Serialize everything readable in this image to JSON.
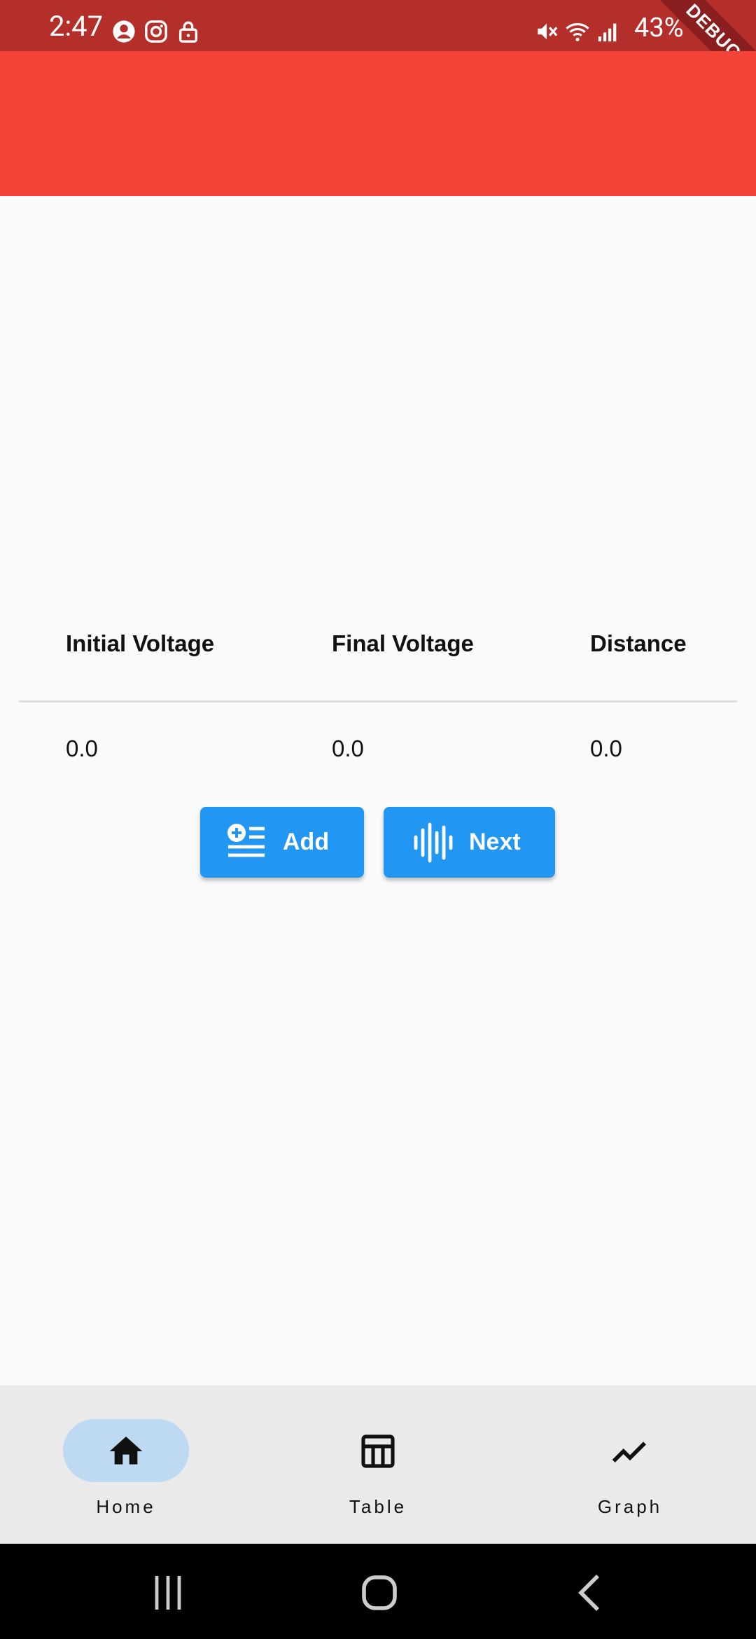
{
  "status_bar": {
    "time": "2:47",
    "battery": "43%",
    "left_icons": [
      "account-circle-icon",
      "instagram-icon",
      "lock-icon"
    ],
    "right_icons": [
      "mute-icon",
      "wifi-icon",
      "signal-icon"
    ]
  },
  "debug_banner": "DEBUG",
  "colors": {
    "status_bar": "#b52f2a",
    "app_bar": "#f44336",
    "button": "#2196f3",
    "nav_active": "#bedaf2",
    "bottom_nav_bg": "#eaeaea"
  },
  "table": {
    "headers": [
      "Initial Voltage",
      "Final Voltage",
      "Distance"
    ],
    "row": [
      "0.0",
      "0.0",
      "0.0"
    ]
  },
  "buttons": {
    "add": {
      "label": "Add",
      "icon": "playlist-add-icon"
    },
    "next": {
      "label": "Next",
      "icon": "waveform-icon"
    }
  },
  "bottom_nav": {
    "items": [
      {
        "label": "Home",
        "icon": "home-icon",
        "active": true
      },
      {
        "label": "Table",
        "icon": "table-icon",
        "active": false
      },
      {
        "label": "Graph",
        "icon": "graph-icon",
        "active": false
      }
    ]
  },
  "system_nav": [
    "recents-button",
    "home-button",
    "back-button"
  ]
}
